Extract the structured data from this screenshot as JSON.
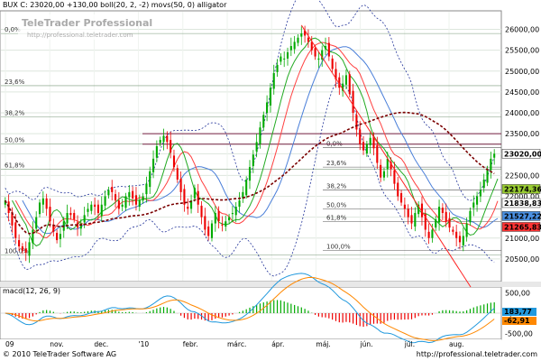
{
  "header": {
    "title": "BUX C: 23020,00 +130,00 boll(20, 2, -2) movs(50, 0) alligator",
    "watermark_brand": "TeleTrader Professional",
    "watermark_url": "http://professional.teletrader.com"
  },
  "macd": {
    "title": "macd(12, 26, 9)",
    "value_1": "183,77",
    "value_2": "-62,91",
    "axis_labels": [
      "500,00",
      "0,00",
      "-500,00"
    ]
  },
  "footer": {
    "copyright": "© 2010 TeleTrader Software AG",
    "url": "http://professional.teletrader.com"
  },
  "chart_data": {
    "type": "candlestick",
    "title": "BUX C: 23020,00 +130,00 boll(20, 2, -2) movs(50, 0) alligator",
    "x_tick_labels": [
      "09",
      "nov.",
      "dec.",
      "'10",
      "febr.",
      "márc.",
      "ápr.",
      "máj.",
      "jún.",
      "júl.",
      "aug."
    ],
    "y_tick_labels": [
      "26000,00",
      "25500,00",
      "25000,00",
      "24500,00",
      "24000,00",
      "23500,00",
      "23020,00",
      "22500,00",
      "22000,00",
      "21500,00",
      "21000,00",
      "20500,00"
    ],
    "ylim": [
      20000,
      26400
    ],
    "price_tags": [
      {
        "text": "23020,00",
        "value": 23020,
        "color": "#ffffff"
      },
      {
        "text": "22174,36",
        "value": 22174,
        "color": "#9acd32"
      },
      {
        "text": "21838,83",
        "value": 21839,
        "color": "#ffffff"
      },
      {
        "text": "21527,22",
        "value": 21527,
        "color": "#4a90e2"
      },
      {
        "text": "21265,83",
        "value": 21266,
        "color": "#ff3333"
      }
    ],
    "fib_left": [
      {
        "label": "0,0%",
        "value": 25900
      },
      {
        "label": "23,6%",
        "value": 24650
      },
      {
        "label": "38,2%",
        "value": 23900
      },
      {
        "label": "50,0%",
        "value": 23250
      },
      {
        "label": "61,8%",
        "value": 22650
      },
      {
        "label": "100,0%",
        "value": 20600
      }
    ],
    "fib_right": [
      {
        "label": "0,0%",
        "value": 23170
      },
      {
        "label": "23,6%",
        "value": 22700
      },
      {
        "label": "38,2%",
        "value": 22150
      },
      {
        "label": "50,0%",
        "value": 21700
      },
      {
        "label": "61,8%",
        "value": 21400
      },
      {
        "label": "100,0%",
        "value": 20700
      }
    ],
    "horizontal_lines": [
      23500,
      23250
    ],
    "colors": {
      "up": "#00aa00",
      "down": "#ee0000",
      "ma50": "#7a0000",
      "boll": "#223399",
      "gator_blue": "#4a7fd9",
      "gator_red": "#ff4040",
      "gator_green": "#22aa22",
      "trend": "#ff2222"
    },
    "closes": [
      21900,
      21600,
      21300,
      21000,
      20800,
      20700,
      20650,
      20900,
      21200,
      21500,
      21850,
      21950,
      21700,
      21400,
      21150,
      20950,
      21100,
      21400,
      21600,
      21550,
      21450,
      21250,
      21350,
      21550,
      21700,
      21800,
      21750,
      21600,
      21800,
      22000,
      22150,
      22100,
      21900,
      21700,
      21800,
      22000,
      22100,
      21950,
      21800,
      21900,
      22000,
      22300,
      22600,
      22900,
      23200,
      23350,
      23450,
      23300,
      23050,
      22700,
      22400,
      22100,
      21800,
      21700,
      21900,
      22200,
      21800,
      21500,
      21200,
      21050,
      21350,
      21600,
      21400,
      21300,
      21400,
      21500,
      21600,
      21750,
      21900,
      22100,
      22400,
      22700,
      23000,
      23300,
      23650,
      23950,
      24250,
      24600,
      24950,
      25150,
      25350,
      25300,
      25450,
      25600,
      25700,
      25800,
      25900,
      25850,
      25700,
      25500,
      25350,
      25300,
      25500,
      25600,
      25350,
      25050,
      24800,
      24600,
      24700,
      24900,
      24450,
      24000,
      23600,
      23250,
      23100,
      23250,
      23400,
      23150,
      22800,
      22450,
      22600,
      22900,
      22650,
      22300,
      22000,
      21850,
      21700,
      21500,
      21350,
      21600,
      21800,
      21500,
      21200,
      21000,
      21200,
      21450,
      21750,
      21600,
      21400,
      21250,
      21150,
      21000,
      20900,
      21050,
      21350,
      21650,
      21850,
      22000,
      22150,
      22400,
      22650,
      22900,
      23020
    ]
  }
}
